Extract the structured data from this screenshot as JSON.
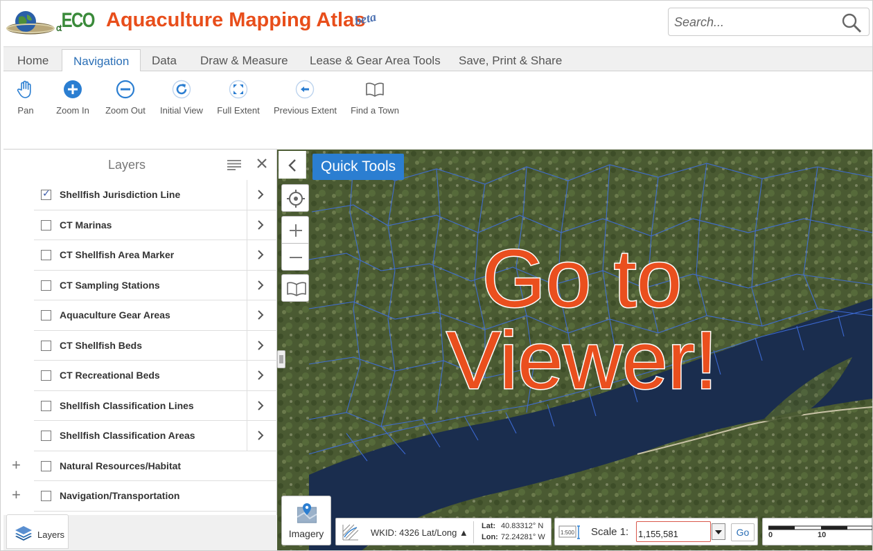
{
  "header": {
    "logo_text": "ECO",
    "logo_prefix": "ct",
    "title": "Aquaculture Mapping Atlas",
    "badge": "beta",
    "search": {
      "placeholder": "Search..."
    }
  },
  "tabs": [
    {
      "label": "Home",
      "active": false
    },
    {
      "label": "Navigation",
      "active": true
    },
    {
      "label": "Data",
      "active": false
    },
    {
      "label": "Draw & Measure",
      "active": false
    },
    {
      "label": "Lease & Gear Area Tools",
      "active": false
    },
    {
      "label": "Save, Print & Share",
      "active": false
    }
  ],
  "ribbon": {
    "tools": [
      {
        "label": "Pan",
        "icon": "hand-icon"
      },
      {
        "label": "Zoom In",
        "icon": "zoom-in-icon"
      },
      {
        "label": "Zoom Out",
        "icon": "zoom-out-icon"
      },
      {
        "label": "Initial View",
        "icon": "refresh-icon"
      },
      {
        "label": "Full Extent",
        "icon": "full-extent-icon"
      },
      {
        "label": "Previous Extent",
        "icon": "back-arrow-icon"
      },
      {
        "label": "Find a Town",
        "icon": "book-icon"
      }
    ]
  },
  "layers": {
    "title": "Layers",
    "items": [
      {
        "name": "Shellfish Jurisdiction Line",
        "checked": true,
        "group": false
      },
      {
        "name": "CT Marinas",
        "checked": false,
        "group": false
      },
      {
        "name": "CT Shellfish Area Marker",
        "checked": false,
        "group": false
      },
      {
        "name": "CT Sampling Stations",
        "checked": false,
        "group": false
      },
      {
        "name": "Aquaculture Gear Areas",
        "checked": false,
        "group": false
      },
      {
        "name": "CT Shellfish Beds",
        "checked": false,
        "group": false
      },
      {
        "name": "CT Recreational Beds",
        "checked": false,
        "group": false
      },
      {
        "name": "Shellfish Classification Lines",
        "checked": false,
        "group": false
      },
      {
        "name": "Shellfish Classification Areas",
        "checked": false,
        "group": false
      },
      {
        "name": "Natural Resources/Habitat",
        "checked": false,
        "group": true
      },
      {
        "name": "Navigation/Transportation",
        "checked": false,
        "group": true
      }
    ],
    "bottom_tab_label": "Layers"
  },
  "map": {
    "quick_tools_label": "Quick Tools",
    "overlay_line1": "Go to",
    "overlay_line2": "Viewer!",
    "imagery_label": "Imagery",
    "colors": {
      "accent": "#2b7ed1",
      "overlay": "#ea4f1e",
      "boundary": "#3f6fe0",
      "water": "#1a2d4e"
    }
  },
  "coords": {
    "wkid": "WKID: 4326 Lat/Long ▲",
    "lat_label": "Lat:",
    "lat_value": "40.83312° N",
    "lon_label": "Lon:",
    "lon_value": "72.24281° W"
  },
  "scale": {
    "label": "Scale 1:",
    "value": "1,155,581",
    "go_label": "Go",
    "icon_text": "1:500"
  },
  "scalebar": {
    "ticks": [
      "0",
      "10"
    ]
  }
}
